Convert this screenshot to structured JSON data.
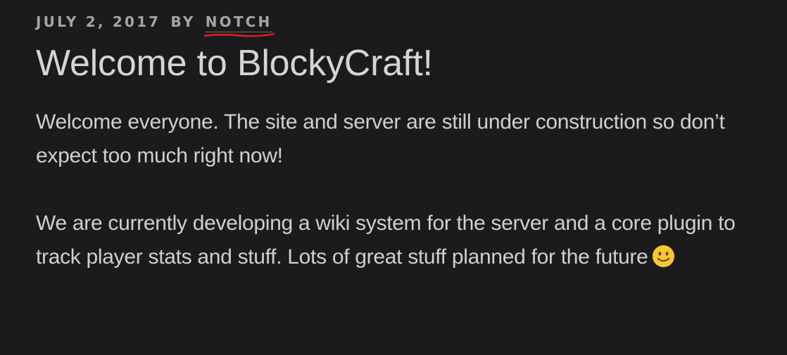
{
  "post": {
    "date": "JULY 2, 2017",
    "by_label": "BY",
    "author": "NOTCH",
    "title": "Welcome to BlockyCraft!",
    "paragraphs": [
      "Welcome everyone. The site and server are still under construction so don’t expect too much right now!",
      "We are currently developing a wiki system for the server and a core plugin to track player stats and stuff. Lots of great stuff planned for the future"
    ],
    "emoji_icon": "slightly-smiling-face-icon"
  },
  "colors": {
    "background": "#1b1b1d",
    "text": "#d8d4cf",
    "meta": "#a9a39b",
    "spellcheck_underline": "#e0201c",
    "emoji_yellow": "#f7c631"
  }
}
